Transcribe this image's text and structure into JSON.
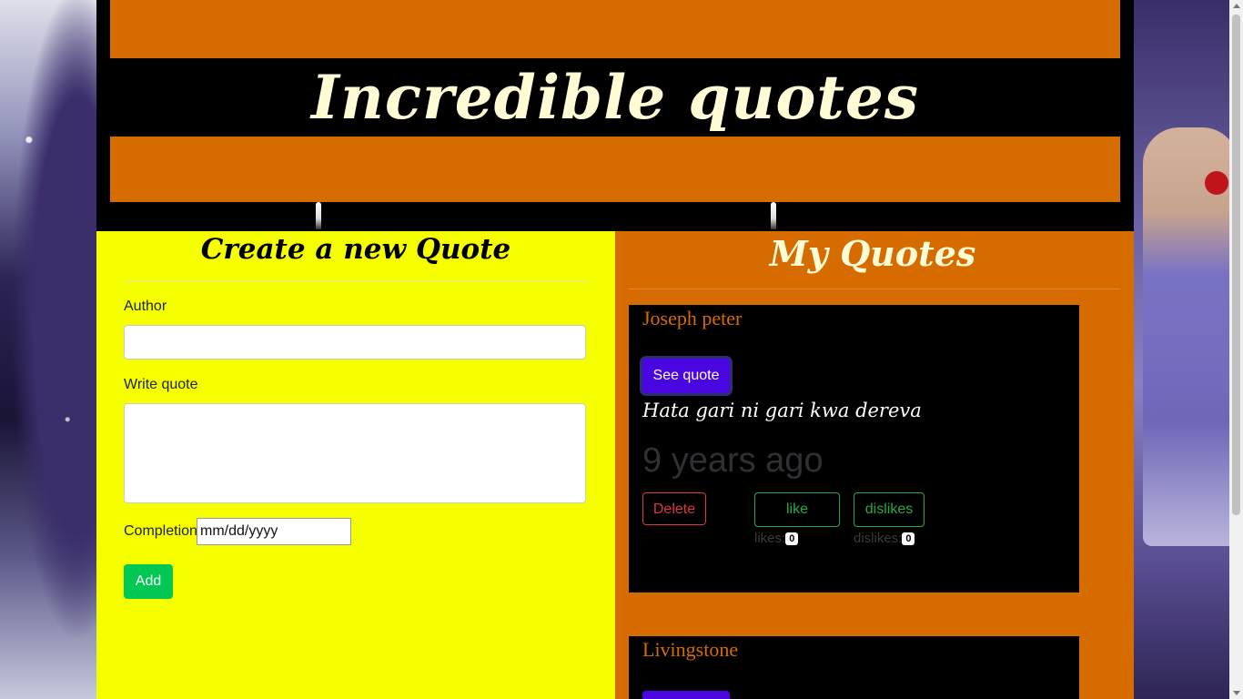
{
  "header": {
    "site_title": "Incredible quotes"
  },
  "create_form": {
    "title": "Create a new Quote",
    "author_label": "Author",
    "author_value": "",
    "quote_label": "Write quote",
    "quote_value": "",
    "completion_label": "Completion",
    "completion_placeholder": "mm/dd/yyyy",
    "add_label": "Add"
  },
  "my_quotes": {
    "title": "My Quotes",
    "quotes": [
      {
        "author": "Joseph peter",
        "see_label": "See quote",
        "text": "Hata gari ni gari kwa dereva",
        "time_ago": "9 years ago",
        "delete_label": "Delete",
        "like_label": "like",
        "dislike_label": "dislikes",
        "likes_label": "likes:",
        "likes_count": "0",
        "dislikes_label": "dislikes:",
        "dislikes_count": "0"
      },
      {
        "author": "Livingstone"
      }
    ]
  },
  "colors": {
    "orange": "#d66b00",
    "yellow": "#f5ff00",
    "see_quote_purple": "#4a06e0",
    "add_green": "#00c853",
    "delete_red": "#dc3545",
    "like_green": "#28a745"
  }
}
